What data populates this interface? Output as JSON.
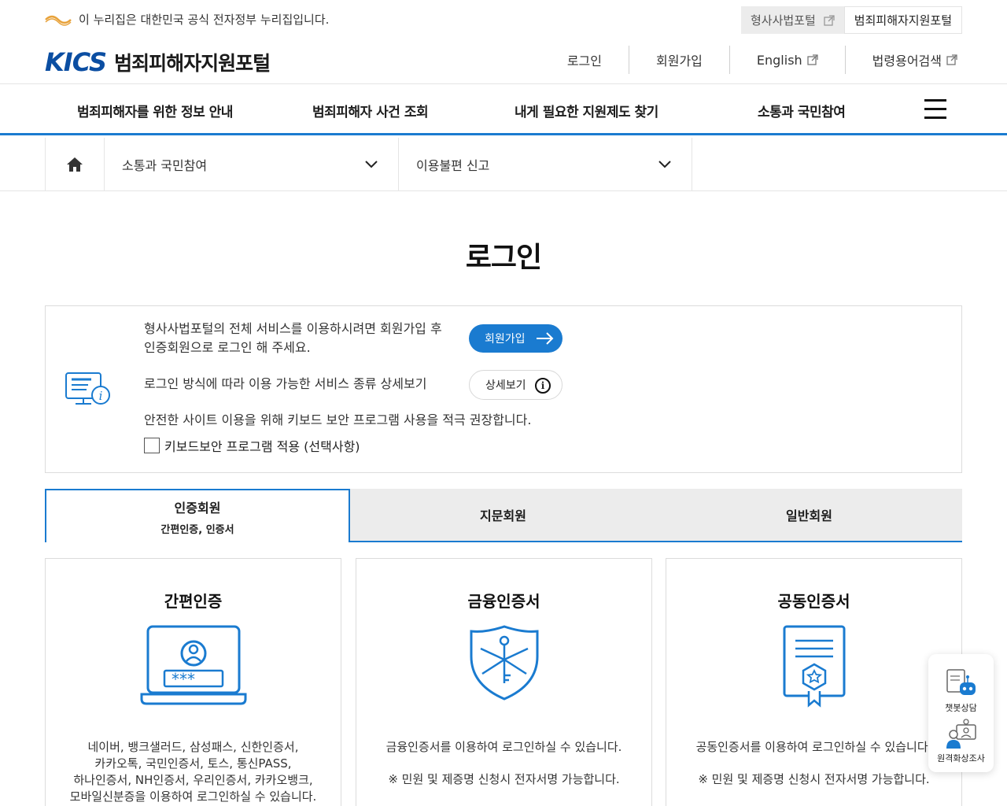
{
  "gov_banner": {
    "text": "이 누리집은 대한민국 공식 전자정부 누리집입니다.",
    "links": [
      {
        "label": "형사사법포털",
        "external": true,
        "active": false
      },
      {
        "label": "범죄피해자지원포털",
        "external": false,
        "active": true
      }
    ]
  },
  "header": {
    "logo_mark": "KICS",
    "logo_text": "범죄피해자지원포털",
    "util": [
      {
        "label": "로그인",
        "external": false
      },
      {
        "label": "회원가입",
        "external": false
      },
      {
        "label": "English",
        "external": true
      },
      {
        "label": "법령용어검색",
        "external": true
      }
    ]
  },
  "gnb": {
    "items": [
      {
        "label": "범죄피해자를 위한 정보 안내"
      },
      {
        "label": "범죄피해자 사건 조회"
      },
      {
        "label": "내게 필요한 지원제도 찾기"
      },
      {
        "label": "소통과 국민참여"
      }
    ]
  },
  "breadcrumb": {
    "level1": "소통과 국민참여",
    "level2": "이용불편 신고"
  },
  "page": {
    "title": "로그인"
  },
  "info": {
    "line1": "형사사법포털의 전체 서비스를 이용하시려면 회원가입 후",
    "line2": "인증회원으로 로그인 해 주세요.",
    "line3": "로그인 방식에 따라 이용 가능한 서비스 종류 상세보기",
    "line4": "안전한 사이트 이용을 위해 키보드 보안 프로그램 사용을 적극 권장합니다.",
    "join_label": "회원가입",
    "detail_label": "상세보기",
    "checkbox_label": "키보드보안 프로그램 적용 (선택사항)",
    "checkbox_checked": false
  },
  "tabs": [
    {
      "label": "인증회원",
      "sub": "간편인증, 인증서",
      "active": true
    },
    {
      "label": "지문회원",
      "sub": "",
      "active": false
    },
    {
      "label": "일반회원",
      "sub": "",
      "active": false
    }
  ],
  "cards": [
    {
      "title": "간편인증",
      "icon": "laptop-password-icon",
      "password_mask": "***",
      "desc": [
        "네이버, 뱅크샐러드, 삼성패스, 신한인증서,",
        "카카오톡, 국민인증서, 토스, 통신PASS,",
        "하나인증서, NH인증서, 우리인증서, 카카오뱅크,",
        "모바일신분증을 이용하여 로그인하실 수 있습니다."
      ]
    },
    {
      "title": "금융인증서",
      "icon": "shield-key-icon",
      "desc": [
        "금융인증서를 이용하여 로그인하실 수 있습니다.",
        "※ 민원 및 제증명 신청시 전자서명 가능합니다."
      ]
    },
    {
      "title": "공동인증서",
      "icon": "certificate-icon",
      "desc": [
        "공동인증서를 이용하여 로그인하실 수 있습니다.",
        "※ 민원 및 제증명 신청시 전자서명 가능합니다."
      ]
    }
  ],
  "quick_menu": [
    {
      "label": "챗봇상담",
      "icon": "chatbot-icon"
    },
    {
      "label": "원격화상조사",
      "icon": "video-call-icon"
    }
  ],
  "colors": {
    "primary": "#1a7bd0",
    "brand": "#0b4ea2",
    "tab_inactive": "#ececec"
  }
}
